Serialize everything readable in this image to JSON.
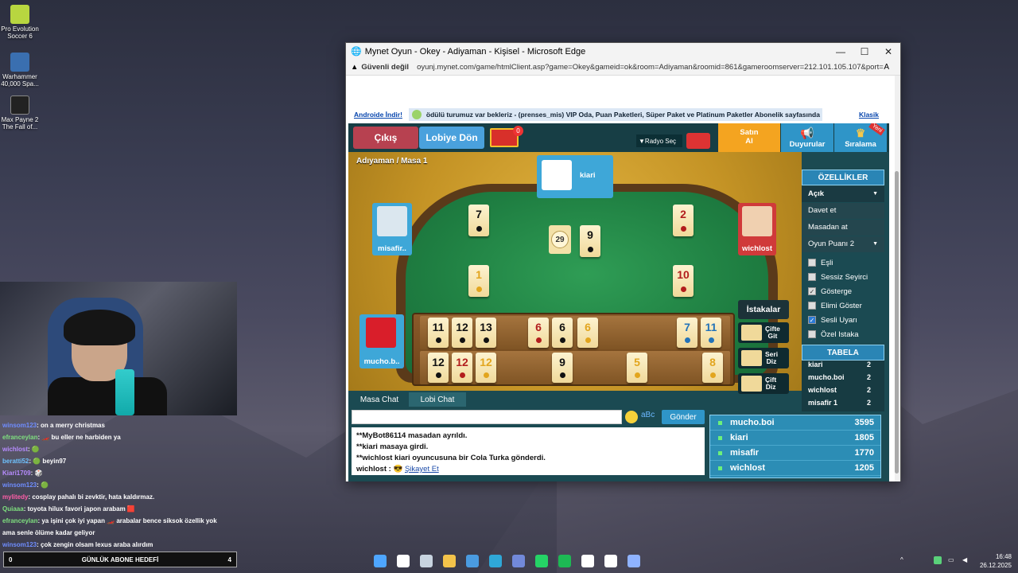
{
  "desktop": {
    "icons": [
      {
        "label1": "Pro Evolution",
        "label2": "Soccer 6",
        "color": "#b8d640"
      },
      {
        "label1": "Warhammer",
        "label2": "40,000 Spa...",
        "color": "#3a6fb0"
      },
      {
        "label1": "Max Payne 2",
        "label2": "The Fall of...",
        "color": "#222222"
      }
    ]
  },
  "window": {
    "title": "Mynet Oyun - Okey - Adiyaman - Kişisel - Microsoft Edge",
    "minimize": "—",
    "maximize": "☐",
    "close": "✕",
    "security": "Güvenli değil",
    "url": "oyunj.mynet.com/game/htmlClient.asp?game=Okey&gameid=ok&room=Adiyaman&roomid=861&gameroomserver=212.101.105.107&port=5..."
  },
  "page": {
    "android_link": "Androide İndir!",
    "marquee": "ödülü turumuz var bekleriz - (prenses_mis)    VIP Oda, Puan Paketleri, Süper Paket ve Platinum Paketler Abonelik sayfasında",
    "classic_link": "Klasik"
  },
  "game": {
    "exit": "Çıkış",
    "lobby": "Lobiye Dön",
    "gift_count": "0",
    "radio": "▼Radyo Seç",
    "buy_l1": "Satın",
    "buy_l2": "Al",
    "announcements": "Duyurular",
    "ranking": "Sıralama",
    "new_badge": "Yeni",
    "room_title": "Adıyaman / Masa 1",
    "counter": "29",
    "players": {
      "top": "kiari",
      "left": "misafir..",
      "right": "wichlost",
      "bottom": "mucho.b.."
    },
    "table_tiles": [
      {
        "n": "7",
        "c": "black"
      },
      {
        "n": "2",
        "c": "red"
      },
      {
        "n": "9",
        "c": "black"
      },
      {
        "n": "1",
        "c": "yellow"
      },
      {
        "n": "10",
        "c": "red"
      }
    ],
    "rack_row1": [
      {
        "n": "11",
        "c": "black"
      },
      {
        "n": "12",
        "c": "black"
      },
      {
        "n": "13",
        "c": "black"
      },
      {
        "n": "6",
        "c": "red"
      },
      {
        "n": "6",
        "c": "black"
      },
      {
        "n": "6",
        "c": "yellow"
      },
      {
        "n": "7",
        "c": "blue"
      },
      {
        "n": "11",
        "c": "blue"
      }
    ],
    "rack_row2": [
      {
        "n": "12",
        "c": "black"
      },
      {
        "n": "12",
        "c": "red"
      },
      {
        "n": "12",
        "c": "yellow"
      },
      {
        "n": "9",
        "c": "black"
      },
      {
        "n": "5",
        "c": "yellow"
      },
      {
        "n": "8",
        "c": "yellow"
      }
    ],
    "istakalar": "İstakalar",
    "cift_git_l1": "Çifte",
    "cift_git_l2": "Git",
    "seri_diz_l1": "Seri",
    "seri_diz_l2": "Diz",
    "cift_diz_l1": "Çift",
    "cift_diz_l2": "Diz",
    "features_title": "ÖZELLİKLER",
    "open": "Açık",
    "invite": "Davet et",
    "kick": "Masadan at",
    "game_points": "Oyun Puanı  2",
    "checks": [
      {
        "label": "Eşli",
        "on": false
      },
      {
        "label": "Sessiz Seyirci",
        "on": false
      },
      {
        "label": "Gösterge",
        "on": true
      },
      {
        "label": "Elimi Göster",
        "on": false
      },
      {
        "label": "Sesli Uyarı",
        "on": true
      },
      {
        "label": "Özel Istaka",
        "on": false
      }
    ],
    "tabela_title": "TABELA",
    "tabela": [
      {
        "n": "kiari",
        "v": "2"
      },
      {
        "n": "mucho.boi",
        "v": "2"
      },
      {
        "n": "wichlost",
        "v": "2"
      },
      {
        "n": "misafir 1",
        "v": "2"
      }
    ],
    "chat_tab1": "Masa Chat",
    "chat_tab2": "Lobi Chat",
    "send": "Gönder",
    "chat_lines": [
      "**MyBot86114 masadan ayrıldı.",
      "**kiari masaya girdi.",
      "**wichlost kiari oyuncusuna bir Cola Turka gönderdi."
    ],
    "last_line_user": "wichlost :",
    "last_line_emoji": "😎",
    "report": "Şikayet Et",
    "scores": [
      {
        "n": "mucho.boi",
        "v": "3595"
      },
      {
        "n": "kiari",
        "v": "1805"
      },
      {
        "n": "misafir",
        "v": "1770"
      },
      {
        "n": "wichlost",
        "v": "1205"
      }
    ]
  },
  "twitch_chat": [
    {
      "u": "winsom123",
      "uc": "#6f8dff",
      "t": ": on a merry christmas"
    },
    {
      "u": "efranceylan",
      "uc": "#7fe07f",
      "t": ": 🏎️ bu eller ne harbiden ya"
    },
    {
      "u": "wichlost",
      "uc": "#b78cff",
      "t": ": 🟢"
    },
    {
      "u": "beratti52",
      "uc": "#6fc3ff",
      "t": ": 🟢 beyin97"
    },
    {
      "u": "Kiari1709",
      "uc": "#b78cff",
      "t": ": 🎲"
    },
    {
      "u": "winsom123",
      "uc": "#6f8dff",
      "t": ": 🟢"
    },
    {
      "u": "mylitedy",
      "uc": "#ff5fa8",
      "t": ": cosplay pahalı bi zevktir, hata kaldırmaz."
    },
    {
      "u": "Quiaaa",
      "uc": "#7fe07f",
      "t": ": toyota hilux favori japon arabam 🟥"
    },
    {
      "u": "efranceylan",
      "uc": "#7fe07f",
      "t": ": ya işini çok iyi yapan 🏎️ arabalar bence siksok özellik yok"
    },
    {
      "u": "",
      "uc": "#ffffff",
      "t": "ama senle ölüme kadar geliyor"
    },
    {
      "u": "winsom123",
      "uc": "#6f8dff",
      "t": ": çok zengin olsam lexus araba alırdım"
    }
  ],
  "goal": {
    "left": "0",
    "title": "GÜNLÜK ABONE HEDEFİ",
    "right": "4"
  },
  "taskbar": {
    "icons": [
      "windows-icon",
      "search-icon",
      "steam-icon",
      "folder-icon",
      "store-icon",
      "edge-icon",
      "discord-icon",
      "whatsapp-icon",
      "spotify-icon",
      "obs-icon",
      "app-icon",
      "app2-icon"
    ],
    "colors": [
      "#4ea6ff",
      "#ffffff",
      "#c8d4e0",
      "#f3c34a",
      "#4a9be0",
      "#2fa8d8",
      "#7289da",
      "#25d366",
      "#1db954",
      "#ffffff",
      "#ffffff",
      "#8fb3ff"
    ],
    "tray": "^",
    "time": "16:48",
    "date": "26.12.2025"
  }
}
